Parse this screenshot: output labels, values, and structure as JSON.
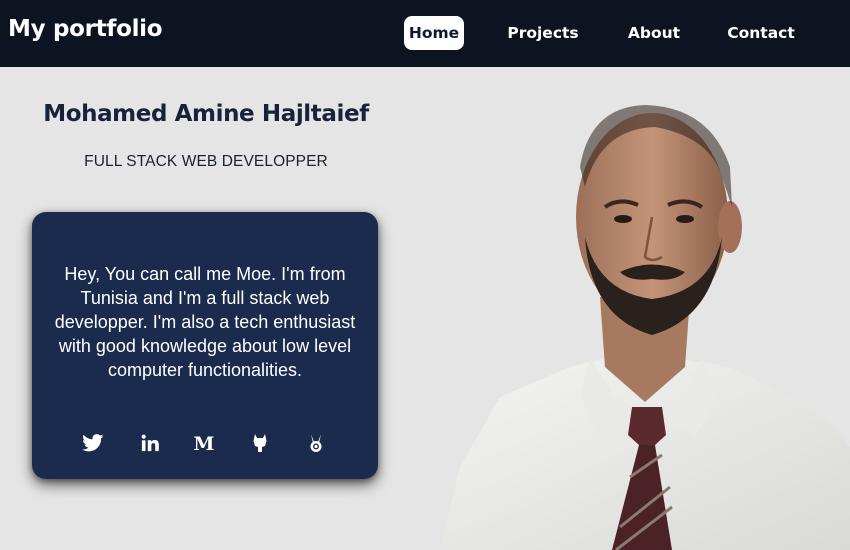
{
  "navbar": {
    "brand": "My portfolio",
    "links": [
      {
        "label": "Home",
        "active": true
      },
      {
        "label": "Projects",
        "active": false
      },
      {
        "label": "About",
        "active": false
      },
      {
        "label": "Contact",
        "active": false
      }
    ]
  },
  "hero": {
    "name": "Mohamed Amine Hajltaief",
    "title": "FULL STACK WEB DEVELOPPER",
    "bio": "Hey, You can call me Moe. I'm from Tunisia and I'm a full stack web developper. I'm also a tech enthusiast with good knowledge about low level computer functionalities."
  },
  "socials": [
    "twitter-icon",
    "linkedin-icon",
    "medium-icon",
    "gitlab-icon",
    "hackthebox-icon"
  ],
  "colors": {
    "navbar_bg": "#0d1421",
    "page_bg": "#e5e5e5",
    "card_bg": "#1b2b4e",
    "heading": "#16233a",
    "active_tab_bg": "#ffffff",
    "active_tab_text": "#0d1a35"
  }
}
